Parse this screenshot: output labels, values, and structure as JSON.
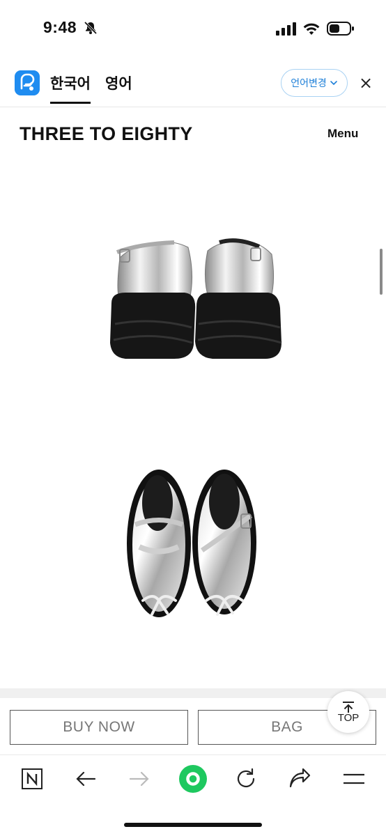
{
  "status_bar": {
    "time": "9:48",
    "icons": [
      "bell-slash-icon",
      "signal-icon",
      "wifi-icon",
      "battery-icon"
    ]
  },
  "translate_bar": {
    "tabs": [
      {
        "label": "한국어",
        "active": true
      },
      {
        "label": "영어",
        "active": false
      }
    ],
    "change_language_label": "언어변경",
    "close_label": "×",
    "logo_color": "#1f8cf0"
  },
  "site_header": {
    "brand": "THREE TO EIGHTY",
    "menu_label": "Menu"
  },
  "product_images": [
    {
      "icon": "silver-platform-mary-jane-back-view-image"
    },
    {
      "icon": "silver-platform-mary-jane-top-view-image"
    }
  ],
  "purchase_bar": {
    "buy_now_label": "BUY NOW",
    "bag_label": "BAG",
    "top_label": "TOP"
  },
  "browser_toolbar": {
    "items": [
      "naver-n-icon",
      "back-arrow-icon",
      "forward-arrow-icon",
      "green-home-icon",
      "refresh-icon",
      "share-icon",
      "hamburger-menu-icon"
    ],
    "accent_color": "#1ec85f"
  }
}
